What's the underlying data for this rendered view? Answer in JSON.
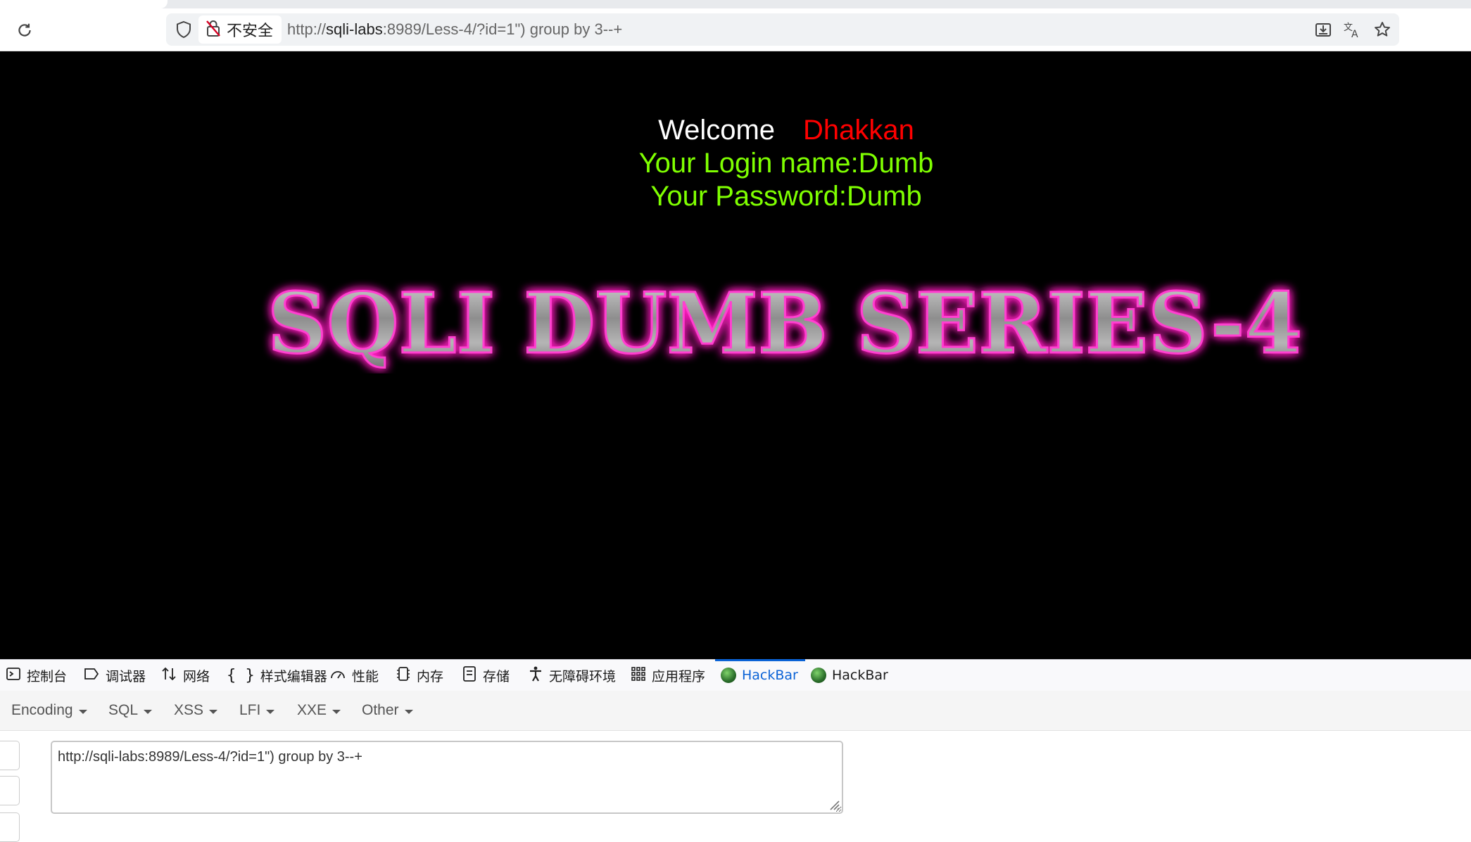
{
  "browser": {
    "security_label": "不安全",
    "url_scheme": "http://",
    "url_host": "sqli-labs",
    "url_rest": ":8989/Less-4/?id=1\") group by 3--+",
    "icons": [
      "reload-icon",
      "shield-icon",
      "not-secure-lock-icon",
      "download-icon",
      "translate-icon",
      "star-icon"
    ]
  },
  "page": {
    "welcome": "Welcome",
    "welcome_name": "Dhakkan",
    "login_line": "Your Login name:Dumb",
    "password_line": "Your Password:Dumb",
    "banner": "SQLI DUMB SERIES-4",
    "colors": {
      "background": "#000000",
      "name": "#ff0000",
      "result": "#7fff00",
      "banner_glow": "#ff1fbf"
    }
  },
  "devtools": {
    "tabs": [
      {
        "label": "控制台",
        "icon": "console-icon"
      },
      {
        "label": "调试器",
        "icon": "debugger-icon"
      },
      {
        "label": "网络",
        "icon": "network-icon"
      },
      {
        "label": "样式编辑器",
        "icon": "style-editor-icon"
      },
      {
        "label": "性能",
        "icon": "performance-icon"
      },
      {
        "label": "内存",
        "icon": "memory-icon"
      },
      {
        "label": "存储",
        "icon": "storage-icon"
      },
      {
        "label": "无障碍环境",
        "icon": "accessibility-icon"
      },
      {
        "label": "应用程序",
        "icon": "application-icon"
      },
      {
        "label": "HackBar",
        "icon": "hackbar-icon",
        "active": true
      },
      {
        "label": "HackBar",
        "icon": "hackbar-icon"
      }
    ],
    "active_color": "#0b63d6"
  },
  "hackbar": {
    "menus": [
      "Encoding",
      "SQL",
      "XSS",
      "LFI",
      "XXE",
      "Other"
    ],
    "url_value": "http://sqli-labs:8989/Less-4/?id=1\") group by 3--+"
  }
}
